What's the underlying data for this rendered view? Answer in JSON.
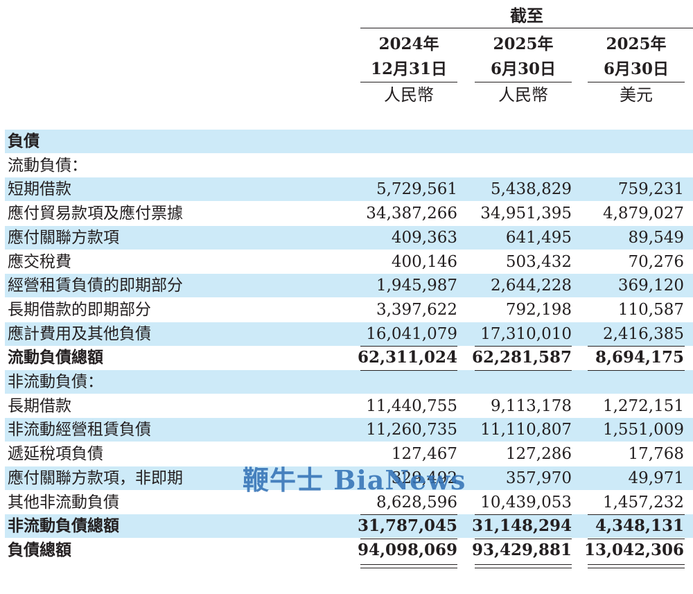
{
  "header": {
    "title": "截至",
    "columns": [
      {
        "year": "2024年",
        "date": "12月31日",
        "currency": "人民幣"
      },
      {
        "year": "2025年",
        "date": "6月30日",
        "currency": "人民幣"
      },
      {
        "year": "2025年",
        "date": "6月30日",
        "currency": "美元"
      }
    ]
  },
  "rows": [
    {
      "label": "負債",
      "values": [
        "",
        "",
        ""
      ],
      "bold": true,
      "shade": true
    },
    {
      "label": "流動負債：",
      "values": [
        "",
        "",
        ""
      ],
      "bold": false,
      "shade": false
    },
    {
      "label": "短期借款",
      "values": [
        "5,729,561",
        "5,438,829",
        "759,231"
      ],
      "bold": false,
      "shade": true
    },
    {
      "label": "應付貿易款項及應付票據",
      "values": [
        "34,387,266",
        "34,951,395",
        "4,879,027"
      ],
      "bold": false,
      "shade": false
    },
    {
      "label": "應付關聯方款項",
      "values": [
        "409,363",
        "641,495",
        "89,549"
      ],
      "bold": false,
      "shade": true
    },
    {
      "label": "應交稅費",
      "values": [
        "400,146",
        "503,432",
        "70,276"
      ],
      "bold": false,
      "shade": false
    },
    {
      "label": "經營租賃負債的即期部分",
      "values": [
        "1,945,987",
        "2,644,228",
        "369,120"
      ],
      "bold": false,
      "shade": true
    },
    {
      "label": "長期借款的即期部分",
      "values": [
        "3,397,622",
        "792,198",
        "110,587"
      ],
      "bold": false,
      "shade": false
    },
    {
      "label": "應計費用及其他負債",
      "values": [
        "16,041,079",
        "17,310,010",
        "2,416,385"
      ],
      "bold": false,
      "shade": true
    },
    {
      "label": "流動負債總額",
      "values": [
        "62,311,024",
        "62,281,587",
        "8,694,175"
      ],
      "bold": true,
      "shade": false
    },
    {
      "label": "非流動負債：",
      "values": [
        "",
        "",
        ""
      ],
      "bold": false,
      "shade": true
    },
    {
      "label": "長期借款",
      "values": [
        "11,440,755",
        "9,113,178",
        "1,272,151"
      ],
      "bold": false,
      "shade": false
    },
    {
      "label": "非流動經營租賃負債",
      "values": [
        "11,260,735",
        "11,110,807",
        "1,551,009"
      ],
      "bold": false,
      "shade": true
    },
    {
      "label": "遞延稅項負債",
      "values": [
        "127,467",
        "127,286",
        "17,768"
      ],
      "bold": false,
      "shade": false
    },
    {
      "label": "應付關聯方款項，非即期",
      "values": [
        "329,492",
        "357,970",
        "49,971"
      ],
      "bold": false,
      "shade": true
    },
    {
      "label": "其他非流動負債",
      "values": [
        "8,628,596",
        "10,439,053",
        "1,457,232"
      ],
      "bold": false,
      "shade": false
    },
    {
      "label": "非流動負債總額",
      "values": [
        "31,787,045",
        "31,148,294",
        "4,348,131"
      ],
      "bold": true,
      "shade": true
    },
    {
      "label": "負債總額",
      "values": [
        "94,098,069",
        "93,429,881",
        "13,042,306"
      ],
      "bold": true,
      "shade": false
    }
  ],
  "watermark": "鞭牛士 BiaNews"
}
